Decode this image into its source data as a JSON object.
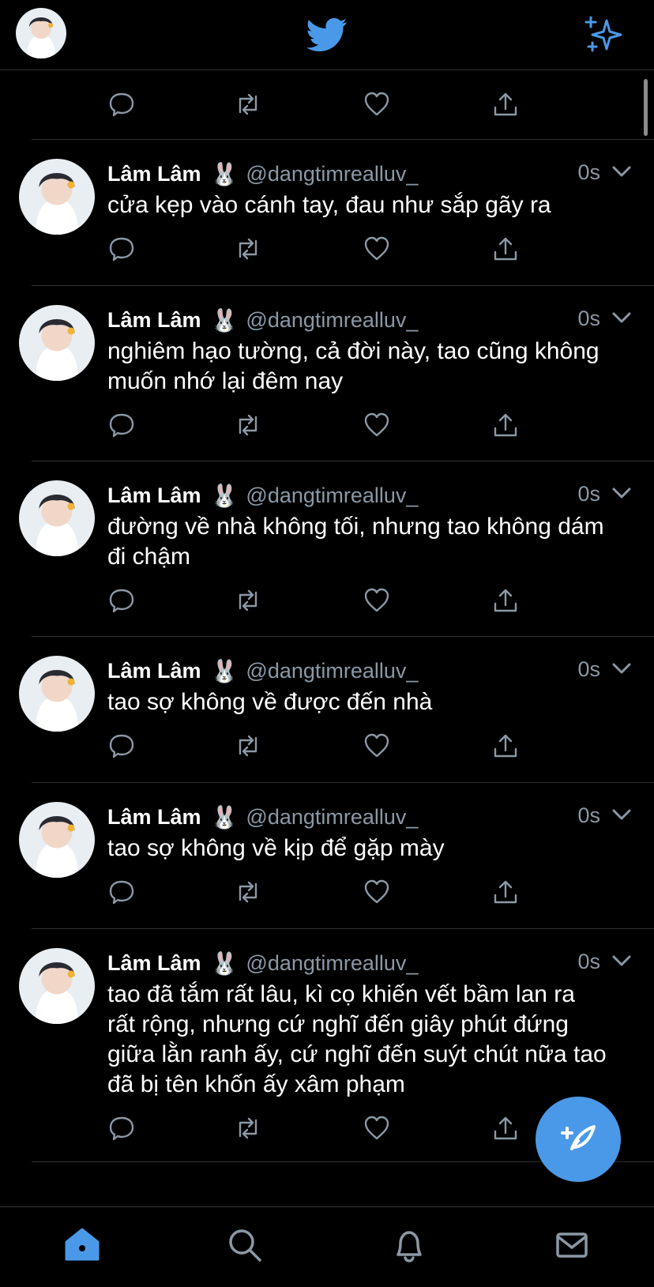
{
  "colors": {
    "accent": "#4a99e9",
    "background": "#000000",
    "muted": "#8b98a5",
    "divider": "#2f3336"
  },
  "header": {
    "logo": "twitter-bird-icon",
    "right_icon": "sparkle-icon"
  },
  "tweets": [
    {
      "name": "Lâm Lâm",
      "emoji": "🐰",
      "handle": "@dangtimrealluv_",
      "time": "0s",
      "text": "cửa kẹp vào cánh tay, đau như sắp gãy ra"
    },
    {
      "name": "Lâm Lâm",
      "emoji": "🐰",
      "handle": "@dangtimrealluv_",
      "time": "0s",
      "text": "nghiêm hạo tường, cả đời này, tao cũng không muốn nhớ lại đêm nay"
    },
    {
      "name": "Lâm Lâm",
      "emoji": "🐰",
      "handle": "@dangtimrealluv_",
      "time": "0s",
      "text": "đường về nhà không tối, nhưng tao không dám đi chậm"
    },
    {
      "name": "Lâm Lâm",
      "emoji": "🐰",
      "handle": "@dangtimrealluv_",
      "time": "0s",
      "text": "tao sợ không về được đến nhà"
    },
    {
      "name": "Lâm Lâm",
      "emoji": "🐰",
      "handle": "@dangtimrealluv_",
      "time": "0s",
      "text": "tao sợ không về kịp để gặp mày"
    },
    {
      "name": "Lâm Lâm",
      "emoji": "🐰",
      "handle": "@dangtimrealluv_",
      "time": "0s",
      "text": "tao đã tắm rất lâu, kì cọ khiến vết bầm lan ra rất rộng, nhưng cứ nghĩ đến giây phút đứng giữa lằn ranh ấy, cứ nghĩ đến suýt chút nữa tao đã bị tên khốn ấy xâm phạm"
    }
  ],
  "action_icons": [
    "reply-icon",
    "retweet-icon",
    "like-icon",
    "share-icon"
  ],
  "fab": {
    "icon": "compose-tweet-icon"
  },
  "bottom_nav": [
    "home-icon",
    "search-icon",
    "notifications-icon",
    "messages-icon"
  ]
}
